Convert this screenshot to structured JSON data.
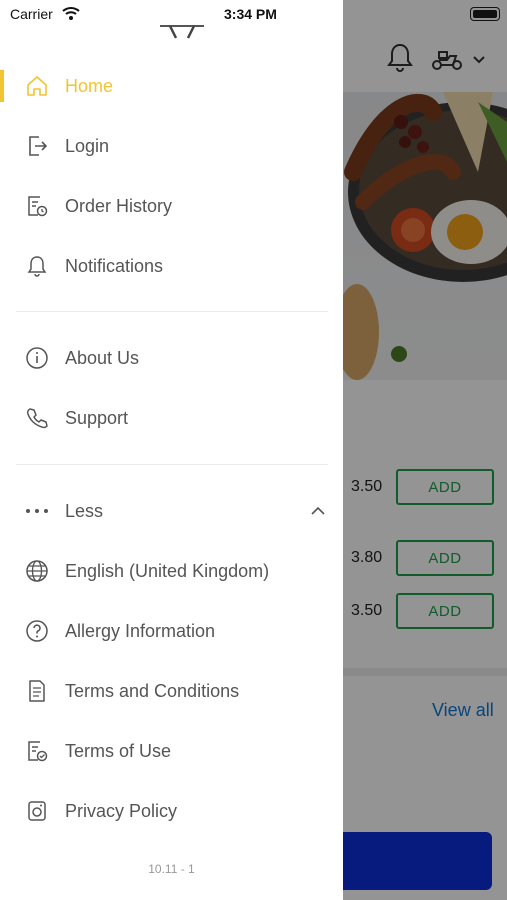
{
  "status_bar": {
    "carrier": "Carrier",
    "time": "3:34 PM"
  },
  "drawer": {
    "primary_items": [
      {
        "label": "Home",
        "icon": "home-icon",
        "active": true
      },
      {
        "label": "Login",
        "icon": "login-icon"
      },
      {
        "label": "Order History",
        "icon": "order-history-icon"
      },
      {
        "label": "Notifications",
        "icon": "bell-icon"
      }
    ],
    "secondary_items": [
      {
        "label": "About Us",
        "icon": "info-icon"
      },
      {
        "label": "Support",
        "icon": "phone-icon"
      }
    ],
    "less_label": "Less",
    "more_items": [
      {
        "label": "English (United Kingdom)",
        "icon": "globe-icon"
      },
      {
        "label": "Allergy Information",
        "icon": "question-icon"
      },
      {
        "label": "Terms and Conditions",
        "icon": "document-icon"
      },
      {
        "label": "Terms of Use",
        "icon": "document-check-icon"
      },
      {
        "label": "Privacy Policy",
        "icon": "privacy-icon"
      }
    ],
    "version": "10.11 - 1"
  },
  "background": {
    "products": [
      {
        "price": "3.50",
        "add_label": "ADD"
      },
      {
        "price": "3.80",
        "add_label": "ADD"
      },
      {
        "price": "3.50",
        "add_label": "ADD"
      }
    ],
    "view_all": "View all"
  },
  "colors": {
    "accent": "#f1c432",
    "add_green": "#1f9e4a",
    "link_blue": "#1178d6",
    "cta_blue": "#0b2fd8"
  }
}
